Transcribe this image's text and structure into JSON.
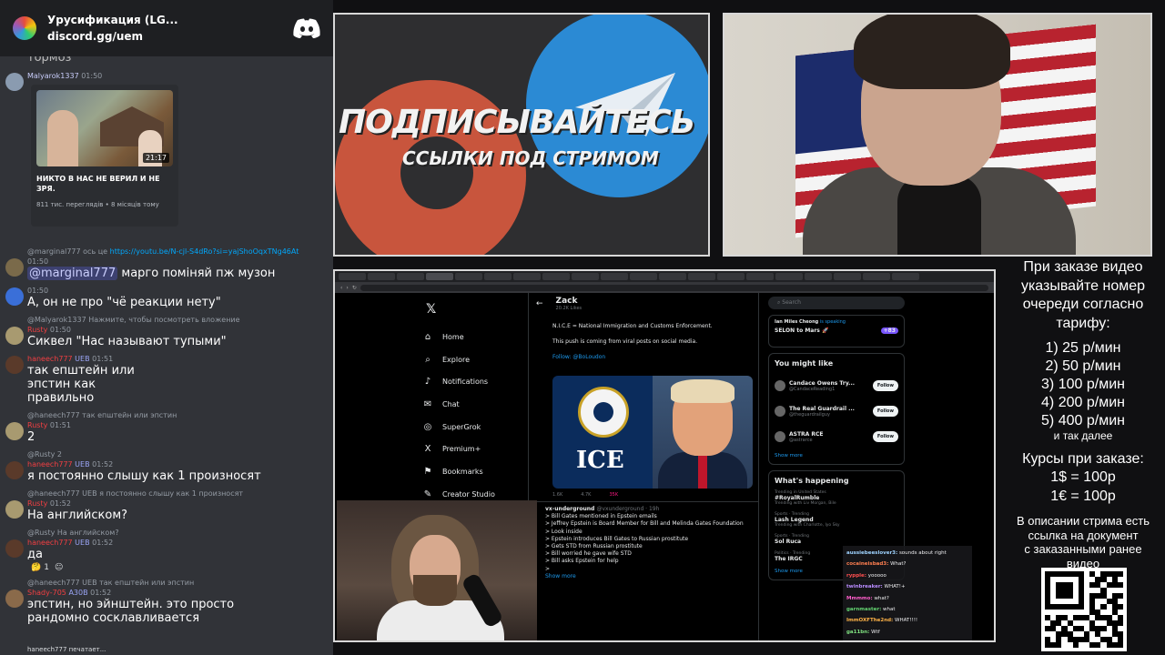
{
  "discord": {
    "server_name": "Урусификация (LG...",
    "invite": "discord.gg/uem",
    "partial_top_text": "тормоз",
    "messages": [
      {
        "user": "Malyarok1337",
        "time": "01:50",
        "embed": {
          "duration": "21:17",
          "title": "НИКТО В НАС НЕ ВЕРИЛ И НЕ ЗРЯ.",
          "views": "811 тис. переглядів • 8 місяців тому"
        }
      },
      {
        "reply": "@marginal777 ось це",
        "reply_link": "https://youtu.be/N-cjl-S4dRo?si=yajShoOqxTNg46At",
        "time": "01:50",
        "mention": "@marginal777",
        "text": "марго поміняй пж музон"
      },
      {
        "time": "01:50",
        "text": "А, он не про \"чё реакции нету\""
      },
      {
        "reply": "@Malyarok1337 Нажмите, чтобы посмотреть вложение",
        "user": "Rusty",
        "time": "01:50",
        "text": "Сиквел \"Нас называют тупыми\""
      },
      {
        "user": "haneech777",
        "badge": "UEB",
        "time": "01:51",
        "text": "так епштейн или эпстин как правильно"
      },
      {
        "reply": "@haneech777 так епштейн или эпстин",
        "user": "Rusty",
        "time": "01:51",
        "text": "2"
      },
      {
        "reply": "@Rusty 2",
        "user": "haneech777",
        "badge": "UEB",
        "time": "01:52",
        "text": "я постоянно слышу как 1 произносят"
      },
      {
        "reply": "@haneech777 UEB я постоянно слышу как 1 произносят",
        "user": "Rusty",
        "time": "01:52",
        "text": "На английском?"
      },
      {
        "reply": "@Rusty На английском?",
        "user": "haneech777",
        "badge": "UEB",
        "time": "01:52",
        "text": "да",
        "reactions": [
          "1",
          "1"
        ]
      },
      {
        "reply": "@haneech777 UEB так епштейн или эпстин",
        "user": "Shady-705",
        "badge": "A30B",
        "time": "01:52",
        "text": "эпстин, но эйнштейн. это просто рандомно сосклавливается"
      }
    ],
    "typing": "haneech777 печатает..."
  },
  "promo": {
    "headline": "ПОДПИСЫВАЙТЕСЬ",
    "subline": "ССЫЛКИ ПОД СТРИМОМ"
  },
  "x": {
    "nav": [
      {
        "icon": "home-icon",
        "glyph": "⌂",
        "label": "Home"
      },
      {
        "icon": "search-icon",
        "glyph": "⌕",
        "label": "Explore"
      },
      {
        "icon": "bell-icon",
        "glyph": "♪",
        "label": "Notifications"
      },
      {
        "icon": "chat-icon",
        "glyph": "✉",
        "label": "Chat"
      },
      {
        "icon": "grok-icon",
        "glyph": "◎",
        "label": "SuperGrok"
      },
      {
        "icon": "x-premium-icon",
        "glyph": "X",
        "label": "Premium+"
      },
      {
        "icon": "bookmark-icon",
        "glyph": "⚑",
        "label": "Bookmarks"
      },
      {
        "icon": "creator-icon",
        "glyph": "✎",
        "label": "Creator Studio"
      }
    ],
    "profile_name": "Zack",
    "profile_sub": "20.2K Likes",
    "post_lines": [
      "N.I.C.E = National Immigration and Customs Enforcement.",
      "This push is coming from viral posts on social media.",
      "Follow: @BoLoudon"
    ],
    "media_text": "ICE",
    "actions": [
      "1.6K",
      "4.7K",
      "35K"
    ],
    "post2_user": "vx-underground",
    "post2_handle": "@vxunderground · 19h",
    "post2_lines": [
      "> Bill Gates mentioned in Epstein emails",
      "> Jeffrey Epstein is Board Member for Bill and Melinda Gates Foundation",
      "> Look inside",
      "> Epstein introduces Bill Gates to Russian prostitute",
      "> Gets STD from Russian prostitute",
      "> Bill worried he gave wife STD",
      "> Bill asks Epstein for help",
      ">"
    ],
    "show_more": "Show more",
    "search_placeholder": "Search",
    "space": {
      "host": "Ian Miles Cheong",
      "status": "is speaking",
      "title": "SELON to Mars 🚀",
      "count": "+83"
    },
    "wtf_title": "You might like",
    "suggestions": [
      {
        "name": "Candace Owens Try...",
        "handle": "@CandaceReading1",
        "btn": "Follow"
      },
      {
        "name": "The Real Guardrail ...",
        "handle": "@theguardrailguy",
        "btn": "Follow"
      },
      {
        "name": "ASTRA RCE",
        "handle": "@astrarce",
        "btn": "Follow"
      }
    ],
    "wtf_more": "Show more",
    "happening_title": "What's happening",
    "trends": [
      {
        "cat": "Trending in United States",
        "title": "#RoyalRumble",
        "sub": "Trending with Liv Morgan, Bile"
      },
      {
        "cat": "Sports · Trending",
        "title": "Lash Legend",
        "sub": "Trending with Charlotte, Iyo Sky"
      },
      {
        "cat": "Sports · Trending",
        "title": "Sol Ruca",
        "sub": ""
      },
      {
        "cat": "Politics · Trending",
        "title": "The IRGC",
        "sub": ""
      }
    ],
    "trends_more": "Show more"
  },
  "twitch_chat": [
    {
      "user": "aussiebeeslover3:",
      "text": "sounds about right",
      "color": "#9fd3ff"
    },
    {
      "user": "cocaineisbad3:",
      "text": "What?",
      "color": "#ff7f50"
    },
    {
      "user": "rypple:",
      "text": "yooooo",
      "color": "#ff4f4f"
    },
    {
      "user": "twinbreaker:",
      "text": "WHAT!+",
      "color": "#b98cff"
    },
    {
      "user": "Mmmmo:",
      "text": "what?",
      "color": "#ff5ecb"
    },
    {
      "user": "garnmaster:",
      "text": "what",
      "color": "#63d471"
    },
    {
      "user": "ImmOXFThe2nd:",
      "text": "WHAT!!!!",
      "color": "#ffb347"
    },
    {
      "user": "ga11bn:",
      "text": "Wtf",
      "color": "#7fe07f"
    }
  ],
  "info": {
    "intro": [
      "При заказе видео",
      "указывайте номер",
      "очереди согласно",
      "тарифу:"
    ],
    "prices": [
      "1) 25 р/мин",
      "2) 50 р/мин",
      "3) 100 р/мин",
      "4) 200 р/мин",
      "5) 400 р/мин"
    ],
    "etc": "и так далее",
    "rates_title": "Курсы при заказе:",
    "rates": [
      "1$ = 100р",
      "1€ = 100р"
    ],
    "desc": [
      "В описании стрима есть",
      "ссылка на документ",
      "с заказанными ранее",
      "видео"
    ]
  },
  "colors": {
    "discord_bg": "#313338",
    "x_blue": "#1d9bf0",
    "promo_red": "#c8553d",
    "promo_blue": "#2b8ad4"
  }
}
